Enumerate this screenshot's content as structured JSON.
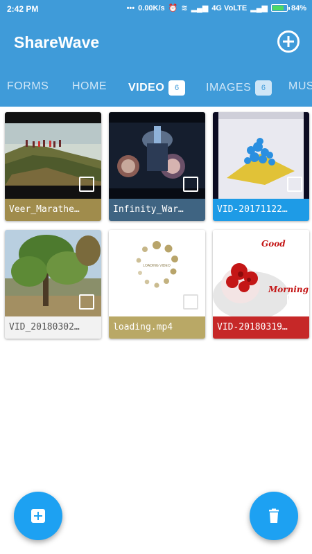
{
  "status_bar": {
    "time": "2:42 PM",
    "speed": "0.00K/s",
    "network": "4G VoLTE",
    "battery": "84%",
    "battery_level": 0.84
  },
  "app": {
    "title": "ShareWave",
    "add_icon": "add-circle-icon"
  },
  "tabs": [
    {
      "label": "FORMS"
    },
    {
      "label": "HOME"
    },
    {
      "label": "VIDEO",
      "badge": "6",
      "active": true
    },
    {
      "label": "IMAGES",
      "badge": "6"
    },
    {
      "label": "MUS"
    }
  ],
  "videos": [
    {
      "name": "Veer_Marathe…",
      "caption_bg": "#a08c4c",
      "caption_color": "#ffffff"
    },
    {
      "name": "Infinity_War…",
      "caption_bg": "#3f6482",
      "caption_color": "#ffffff"
    },
    {
      "name": "VID-20171122…",
      "caption_bg": "#1e9be6",
      "caption_color": "#ffffff"
    },
    {
      "name": "VID_20180302…",
      "caption_bg": "#f2f2f2",
      "caption_color": "#555555"
    },
    {
      "name": "loading.mp4",
      "caption_bg": "#b9a866",
      "caption_color": "#ffffff"
    },
    {
      "name": "VID-20180319…",
      "caption_bg": "#c62828",
      "caption_color": "#ffffff"
    }
  ],
  "thumb_text": {
    "loading": "LOADING VIDEO",
    "good": "Good",
    "morning": "Morning"
  },
  "fabs": {
    "add_icon": "add-box-icon",
    "delete_icon": "trash-icon",
    "color": "#1da1f2"
  },
  "colors": {
    "primary": "#3f9bd9",
    "tab_inactive": "#cfe6f7"
  }
}
